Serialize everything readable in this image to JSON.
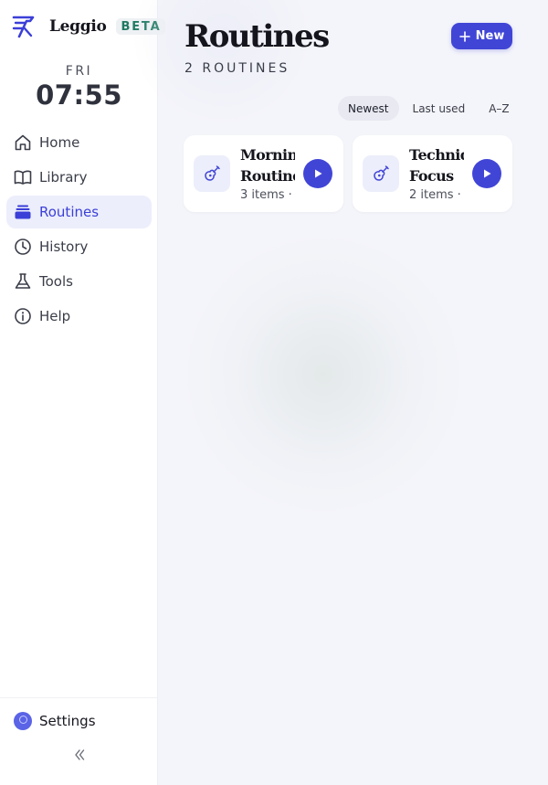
{
  "brand": {
    "name": "Leggio",
    "badge": "BETA"
  },
  "clock": {
    "day": "FRI",
    "time": "07:55"
  },
  "nav": {
    "items": [
      {
        "label": "Home",
        "icon": "home-icon"
      },
      {
        "label": "Library",
        "icon": "book-icon"
      },
      {
        "label": "Routines",
        "icon": "layers-icon",
        "active": true
      },
      {
        "label": "History",
        "icon": "clock-icon"
      },
      {
        "label": "Tools",
        "icon": "flask-icon"
      },
      {
        "label": "Help",
        "icon": "info-icon"
      }
    ]
  },
  "footer": {
    "settings_label": "Settings",
    "collapse_icon": "double-chevron-left-icon"
  },
  "header": {
    "title": "Routines",
    "count": "2 ROUTINES",
    "new_label": "New"
  },
  "sort": {
    "options": [
      "Newest",
      "Last used",
      "A–Z"
    ],
    "selected": "Newest"
  },
  "routines": [
    {
      "line1": "Morning",
      "line2": "Routine",
      "meta": "3 items · …",
      "icon": "guitar-icon"
    },
    {
      "line1": "Techniq",
      "line2": "Focus",
      "meta": "2 items · …",
      "icon": "guitar-icon"
    }
  ],
  "colors": {
    "accent": "#4145d6",
    "active_bg": "#eceefb",
    "beta": "#1f7a63"
  }
}
